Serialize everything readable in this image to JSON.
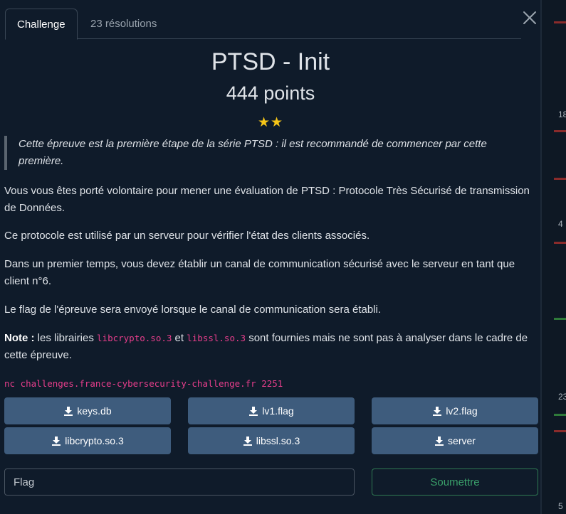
{
  "tabs": [
    {
      "label": "Challenge"
    },
    {
      "label": "23 résolutions"
    }
  ],
  "challenge": {
    "title": "PTSD - Init",
    "points": "444 points",
    "stars": "★★",
    "quote": "Cette épreuve est la première étape de la série PTSD : il est recommandé de commencer par cette première.",
    "p1": "Vous vous êtes porté volontaire pour mener une évaluation de PTSD : Protocole Très Sécurisé de transmission de Données.",
    "p2": "Ce protocole est utilisé par un serveur pour vérifier l'état des clients associés.",
    "p3": "Dans un premier temps, vous devez établir un canal de communication sécurisé avec le serveur en tant que client n°6.",
    "p4": "Le flag de l'épreuve sera envoyé lorsque le canal de communication sera établi.",
    "note_label": "Note :",
    "note_text_1": " les librairies ",
    "note_code_1": "libcrypto.so.3",
    "note_text_2": " et ",
    "note_code_2": "libssl.so.3",
    "note_text_3": " sont fournies mais ne sont pas à analyser dans le cadre de cette épreuve.",
    "command": "nc challenges.france-cybersecurity-challenge.fr 2251"
  },
  "files": [
    {
      "label": "keys.db"
    },
    {
      "label": "lv1.flag"
    },
    {
      "label": "lv2.flag"
    },
    {
      "label": "libcrypto.so.3"
    },
    {
      "label": "libssl.so.3"
    },
    {
      "label": "server"
    }
  ],
  "form": {
    "flag_placeholder": "Flag",
    "submit_label": "Soumettre"
  },
  "background": {
    "numbers": [
      "18",
      "4",
      "23",
      "5"
    ]
  },
  "colors": {
    "accent": "#3e5c7d",
    "submit": "#3aa06a",
    "code": "#e83e8c",
    "star": "#f5c518"
  }
}
